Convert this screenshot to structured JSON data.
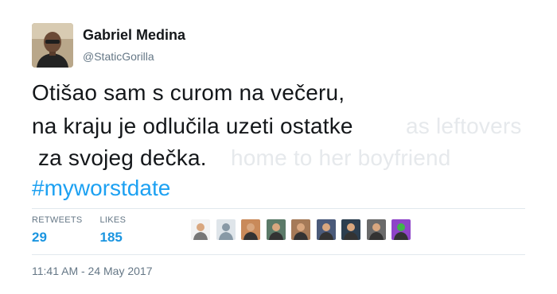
{
  "user": {
    "display_name": "Gabriel Medina",
    "handle": "@StaticGorilla"
  },
  "tweet": {
    "lines": [
      "Otišao sam s curom na večeru,",
      "na kraju je odlučila uzeti ostatke",
      " za svojeg dečka."
    ],
    "hashtag": "#myworstdate",
    "ghost_text": {
      "line2": "as leftovers",
      "line3": "home to her boyfriend"
    }
  },
  "stats": {
    "retweets_label": "RETWEETS",
    "retweets_value": "29",
    "likes_label": "LIKES",
    "likes_value": "185"
  },
  "likers": [
    {
      "name": "liker-avatar-1",
      "color": "#9a9a9a"
    },
    {
      "name": "liker-avatar-2",
      "color": "#b8c1c8"
    },
    {
      "name": "liker-avatar-3",
      "color": "#c98a5a"
    },
    {
      "name": "liker-avatar-4",
      "color": "#5b7a68"
    },
    {
      "name": "liker-avatar-5",
      "color": "#a57a58"
    },
    {
      "name": "liker-avatar-6",
      "color": "#4a5a7a"
    },
    {
      "name": "liker-avatar-7",
      "color": "#2c3e4f"
    },
    {
      "name": "liker-avatar-8",
      "color": "#6a6a6a"
    },
    {
      "name": "liker-avatar-9",
      "color": "#8e44c8"
    }
  ],
  "timestamp": "11:41 AM - 24 May 2017"
}
